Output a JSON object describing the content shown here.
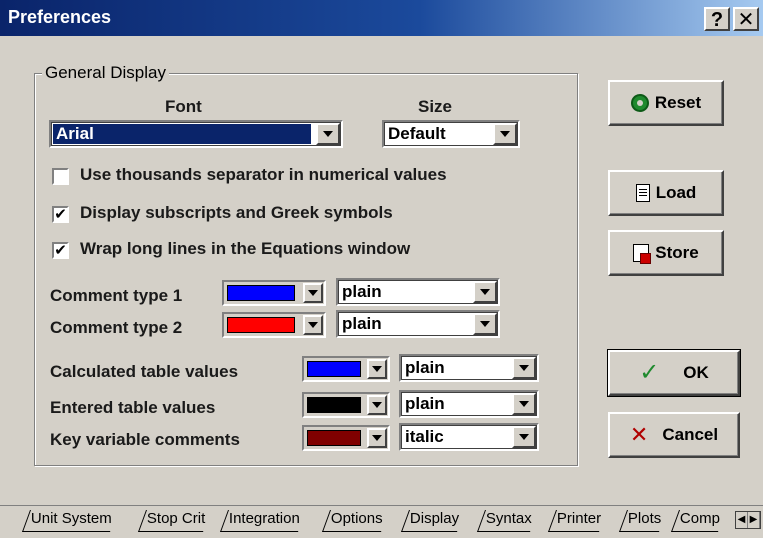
{
  "window": {
    "title": "Preferences",
    "help_label": "?",
    "close_label": "✕"
  },
  "general": {
    "group_label": "General Display",
    "font_caption": "Font",
    "size_caption": "Size",
    "font_value": "Arial",
    "size_value": "Default",
    "checkboxes": [
      {
        "label": "Use thousands separator in numerical values",
        "checked": false
      },
      {
        "label": "Display subscripts and Greek symbols",
        "checked": true
      },
      {
        "label": "Wrap long lines in the Equations window",
        "checked": true
      }
    ],
    "rows": [
      {
        "label": "Comment type 1",
        "color": "#0000ff",
        "style": "plain"
      },
      {
        "label": "Comment type 2",
        "color": "#ff0000",
        "style": "plain"
      },
      {
        "label": "Calculated table values",
        "color": "#0000ff",
        "style": "plain"
      },
      {
        "label": "Entered table values",
        "color": "#000000",
        "style": "plain"
      },
      {
        "label": "Key variable comments",
        "color": "#800000",
        "style": "italic"
      }
    ]
  },
  "buttons": {
    "reset": "Reset",
    "load": "Load",
    "store": "Store",
    "ok": "OK",
    "cancel": "Cancel",
    "icons": {
      "reset": "reset-icon",
      "load": "load-icon",
      "store": "store-icon",
      "ok": "checkmark-icon",
      "cancel": "x-icon"
    },
    "check_mark": "✓",
    "x_mark": "✕"
  },
  "tabs": [
    {
      "label": "Unit System",
      "active": false
    },
    {
      "label": "Stop Crit",
      "active": false
    },
    {
      "label": "Integration",
      "active": false
    },
    {
      "label": "Options",
      "active": false
    },
    {
      "label": "Display",
      "active": true
    },
    {
      "label": "Syntax",
      "active": false
    },
    {
      "label": "Printer",
      "active": false
    },
    {
      "label": "Plots",
      "active": false
    },
    {
      "label": "Comp",
      "active": false
    }
  ],
  "checked_mark": "✔",
  "colors": {
    "titlebar": "#0a246a",
    "dialog_bg": "#d4d0c8",
    "selection": "#0a246a"
  }
}
